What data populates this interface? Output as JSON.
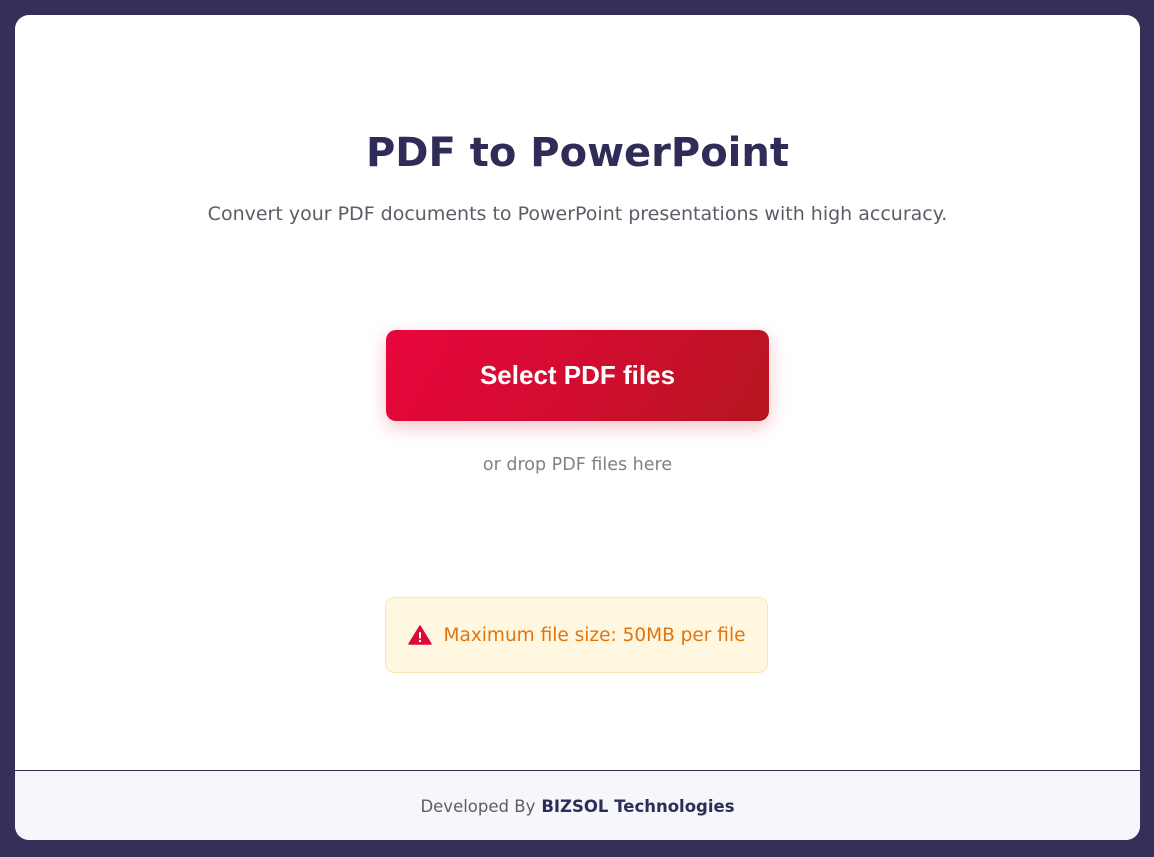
{
  "page": {
    "title": "PDF to PowerPoint",
    "subtitle": "Convert your PDF documents to PowerPoint presentations with high accuracy."
  },
  "upload": {
    "select_button_label": "Select PDF files",
    "drop_hint": "or drop PDF files here"
  },
  "notice": {
    "icon": "warning-triangle-icon",
    "text": "Maximum file size: 50MB per file"
  },
  "footer": {
    "prefix": "Developed By",
    "company": "BIZSOL Technologies"
  },
  "colors": {
    "background": "#34305a",
    "title": "#2f2d57",
    "button_start": "#e8063c",
    "button_end": "#b5161e",
    "warning_bg": "#fff7df",
    "warning_text": "#e3740c",
    "warning_icon": "#dc0a3a"
  }
}
